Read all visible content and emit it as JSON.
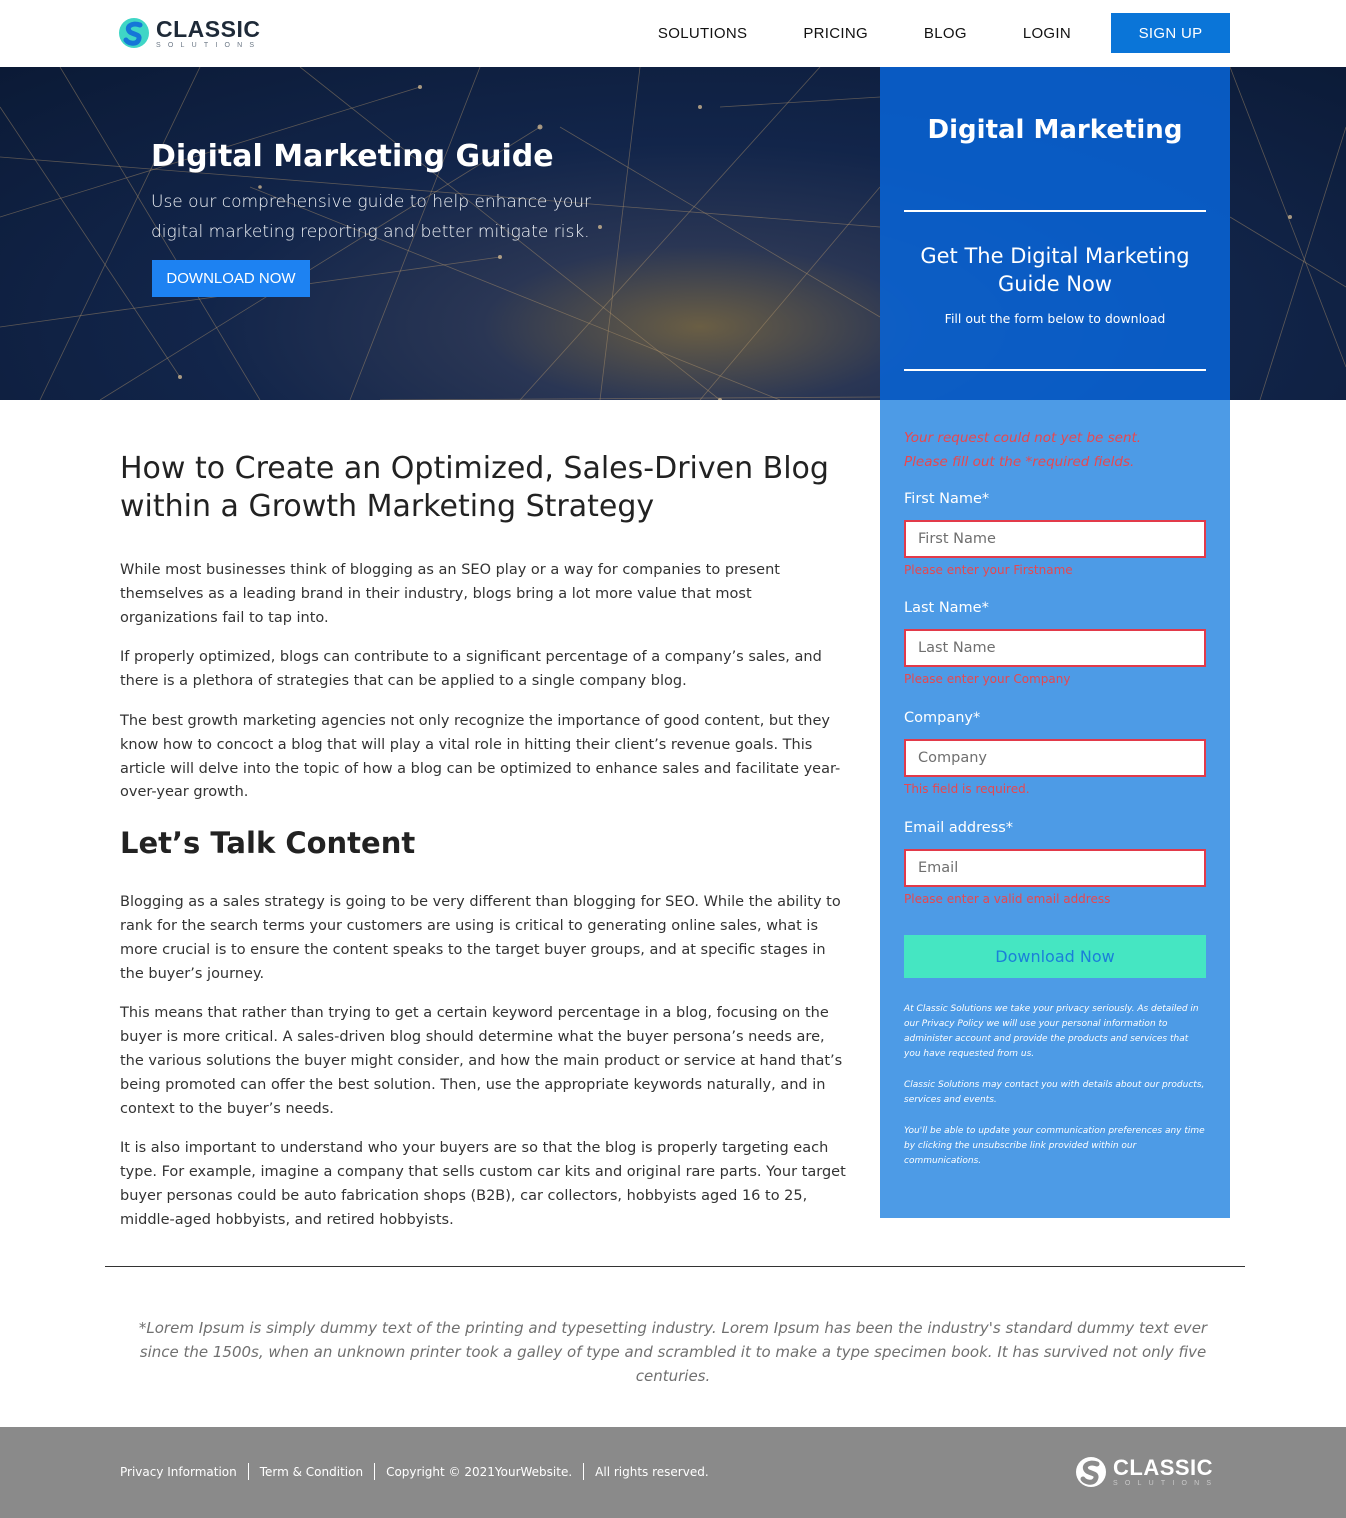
{
  "header": {
    "logo_main": "CLASSIC",
    "logo_sub": "SOLUTIONS",
    "nav": [
      "SOLUTIONS",
      "PRICING",
      "BLOG",
      "LOGIN"
    ],
    "signup_label": "SIGN UP"
  },
  "hero": {
    "title": "Digital Marketing Guide",
    "subtitle": "Use our comprehensive guide to help enhance your digital marketing reporting and better mitigate risk.",
    "button_label": "DOWNLOAD NOW"
  },
  "panel": {
    "title": "Digital Marketing",
    "heading": "Get The Digital Marketing Guide Now",
    "note": "Fill out the form below to download",
    "error_line1": "Your request could not yet be sent.",
    "error_line2": "Please fill out the *required fields.",
    "fields": [
      {
        "label": "First Name*",
        "placeholder": "First Name",
        "error": "Please enter your Firstname"
      },
      {
        "label": "Last Name*",
        "placeholder": "Last Name",
        "error": "Please enter your Company"
      },
      {
        "label": "Company*",
        "placeholder": "Company",
        "error": "This field is required."
      },
      {
        "label": "Email address*",
        "placeholder": "Email",
        "error": "Please enter a valid email address"
      }
    ],
    "submit_label": "Download Now",
    "privacy": [
      "At Classic Solutions we take your privacy seriously. As detailed in our Privacy Policy we will use your personal information to administer account and provide the products and services that you have requested from us.",
      "Classic Solutions may contact you with details about our products, services and events.",
      "You'll be able to update your communication preferences any time by clicking the unsubscribe link provided within our communications."
    ]
  },
  "article": {
    "title": "How to Create an Optimized, Sales-Driven Blog within a Growth Marketing Strategy",
    "paragraphs_1": [
      "While most businesses think of blogging as an SEO play or a way for companies to present themselves as a leading brand in their industry, blogs bring a lot more value that most organizations fail to tap into.",
      "If properly optimized, blogs can contribute to a significant percentage of a company’s sales, and there is a plethora of strategies that can be applied to a single company blog.",
      "The best growth marketing agencies not only recognize the importance of good content, but they know how to concoct a blog that will play a vital role in hitting their client’s revenue goals. This article will delve into the topic of how a blog can be optimized to enhance sales and facilitate year-over-year growth."
    ],
    "subheading": "Let’s Talk Content",
    "paragraphs_2": [
      "Blogging as a sales strategy is going to be very different than blogging for SEO. While the ability to rank for the search terms your customers are using is critical to generating online sales, what is more crucial is to ensure the content speaks to the target buyer groups, and at specific stages in the buyer’s journey.",
      "This means that rather than trying to get a certain keyword percentage in a blog, focusing on the buyer is more critical. A sales-driven blog should determine what the buyer persona’s needs are, the various solutions the buyer might consider, and how the main product or service at hand that’s being promoted can offer the best solution. Then, use the appropriate keywords naturally, and in context to the buyer’s needs.",
      "It is also important to understand who your buyers are so that the blog is properly targeting each type. For example, imagine a company that sells custom car kits and original rare parts. Your target buyer personas could be auto fabrication shops (B2B), car collectors, hobbyists aged 16 to 25, middle-aged hobbyists, and retired hobbyists."
    ]
  },
  "disclaimer": "*Lorem Ipsum is simply dummy text of the printing and typesetting industry. Lorem Ipsum has been the industry's standard dummy text ever since the 1500s, when an unknown printer took a galley of type and scrambled it to make a type specimen book. It has survived not only five centuries.",
  "footer": {
    "links": [
      "Privacy Information",
      "Term & Condition",
      "Copyright © 2021YourWebsite.",
      "All rights reserved."
    ],
    "logo_main": "CLASSIC",
    "logo_sub": "SOLUTIONS"
  },
  "colors": {
    "primary_blue": "#0a75d8",
    "panel_blue": "#4d9be6",
    "error_red": "#e8474f",
    "submit_green": "#45e6c2",
    "footer_gray": "#8a8a8a"
  }
}
